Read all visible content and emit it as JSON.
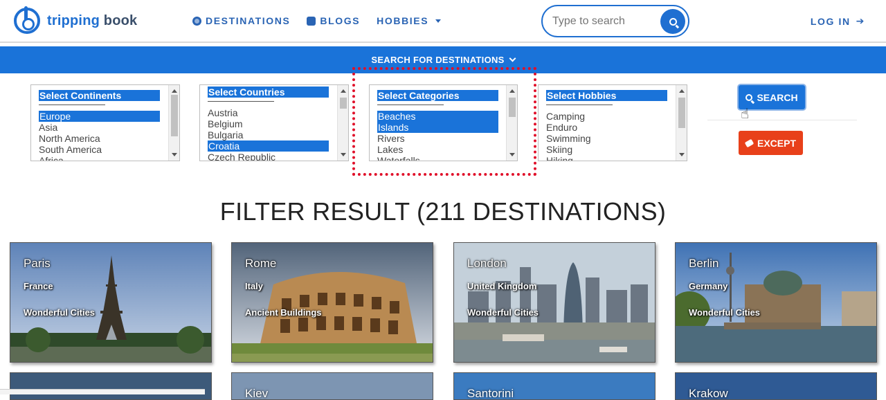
{
  "brand": {
    "name_part1": "tripping",
    "name_part2": "book"
  },
  "nav": {
    "destinations": "DESTINATIONS",
    "blogs": "BLOGS",
    "hobbies": "HOBBIES",
    "login": "LOG IN"
  },
  "search": {
    "placeholder": "Type to search"
  },
  "filter_bar": {
    "label": "SEARCH FOR DESTINATIONS"
  },
  "filters": {
    "continents": {
      "header": "Select Continents",
      "options": [
        "Europe",
        "Asia",
        "North America",
        "South America",
        "Africa"
      ],
      "selected": [
        "Europe"
      ]
    },
    "countries": {
      "header": "Select Countries",
      "options": [
        "Austria",
        "Belgium",
        "Bulgaria",
        "Croatia",
        "Czech Republic"
      ],
      "selected": [
        "Croatia"
      ]
    },
    "categories": {
      "header": "Select Categories",
      "options": [
        "Beaches",
        "Islands",
        "Rivers",
        "Lakes",
        "Waterfalls"
      ],
      "selected": [
        "Beaches",
        "Islands"
      ]
    },
    "hobbies": {
      "header": "Select Hobbies",
      "options": [
        "Camping",
        "Enduro",
        "Swimming",
        "Skiing",
        "Hiking"
      ],
      "selected": []
    }
  },
  "buttons": {
    "search": "SEARCH",
    "except": "EXCEPT"
  },
  "result_title": "FILTER RESULT (211 DESTINATIONS)",
  "cards": [
    {
      "city": "Paris",
      "country": "France",
      "category": "Wonderful Cities"
    },
    {
      "city": "Rome",
      "country": "Italy",
      "category": "Ancient Buildings"
    },
    {
      "city": "London",
      "country": "United Kingdom",
      "category": "Wonderful Cities"
    },
    {
      "city": "Berlin",
      "country": "Germany",
      "category": "Wonderful Cities"
    }
  ],
  "cards_row2": [
    {
      "city": ""
    },
    {
      "city": "Kiev"
    },
    {
      "city": "Santorini"
    },
    {
      "city": "Krakow"
    }
  ],
  "colors": {
    "primary": "#1a73d9",
    "danger": "#e8401a",
    "highlight": "#e0102a"
  }
}
